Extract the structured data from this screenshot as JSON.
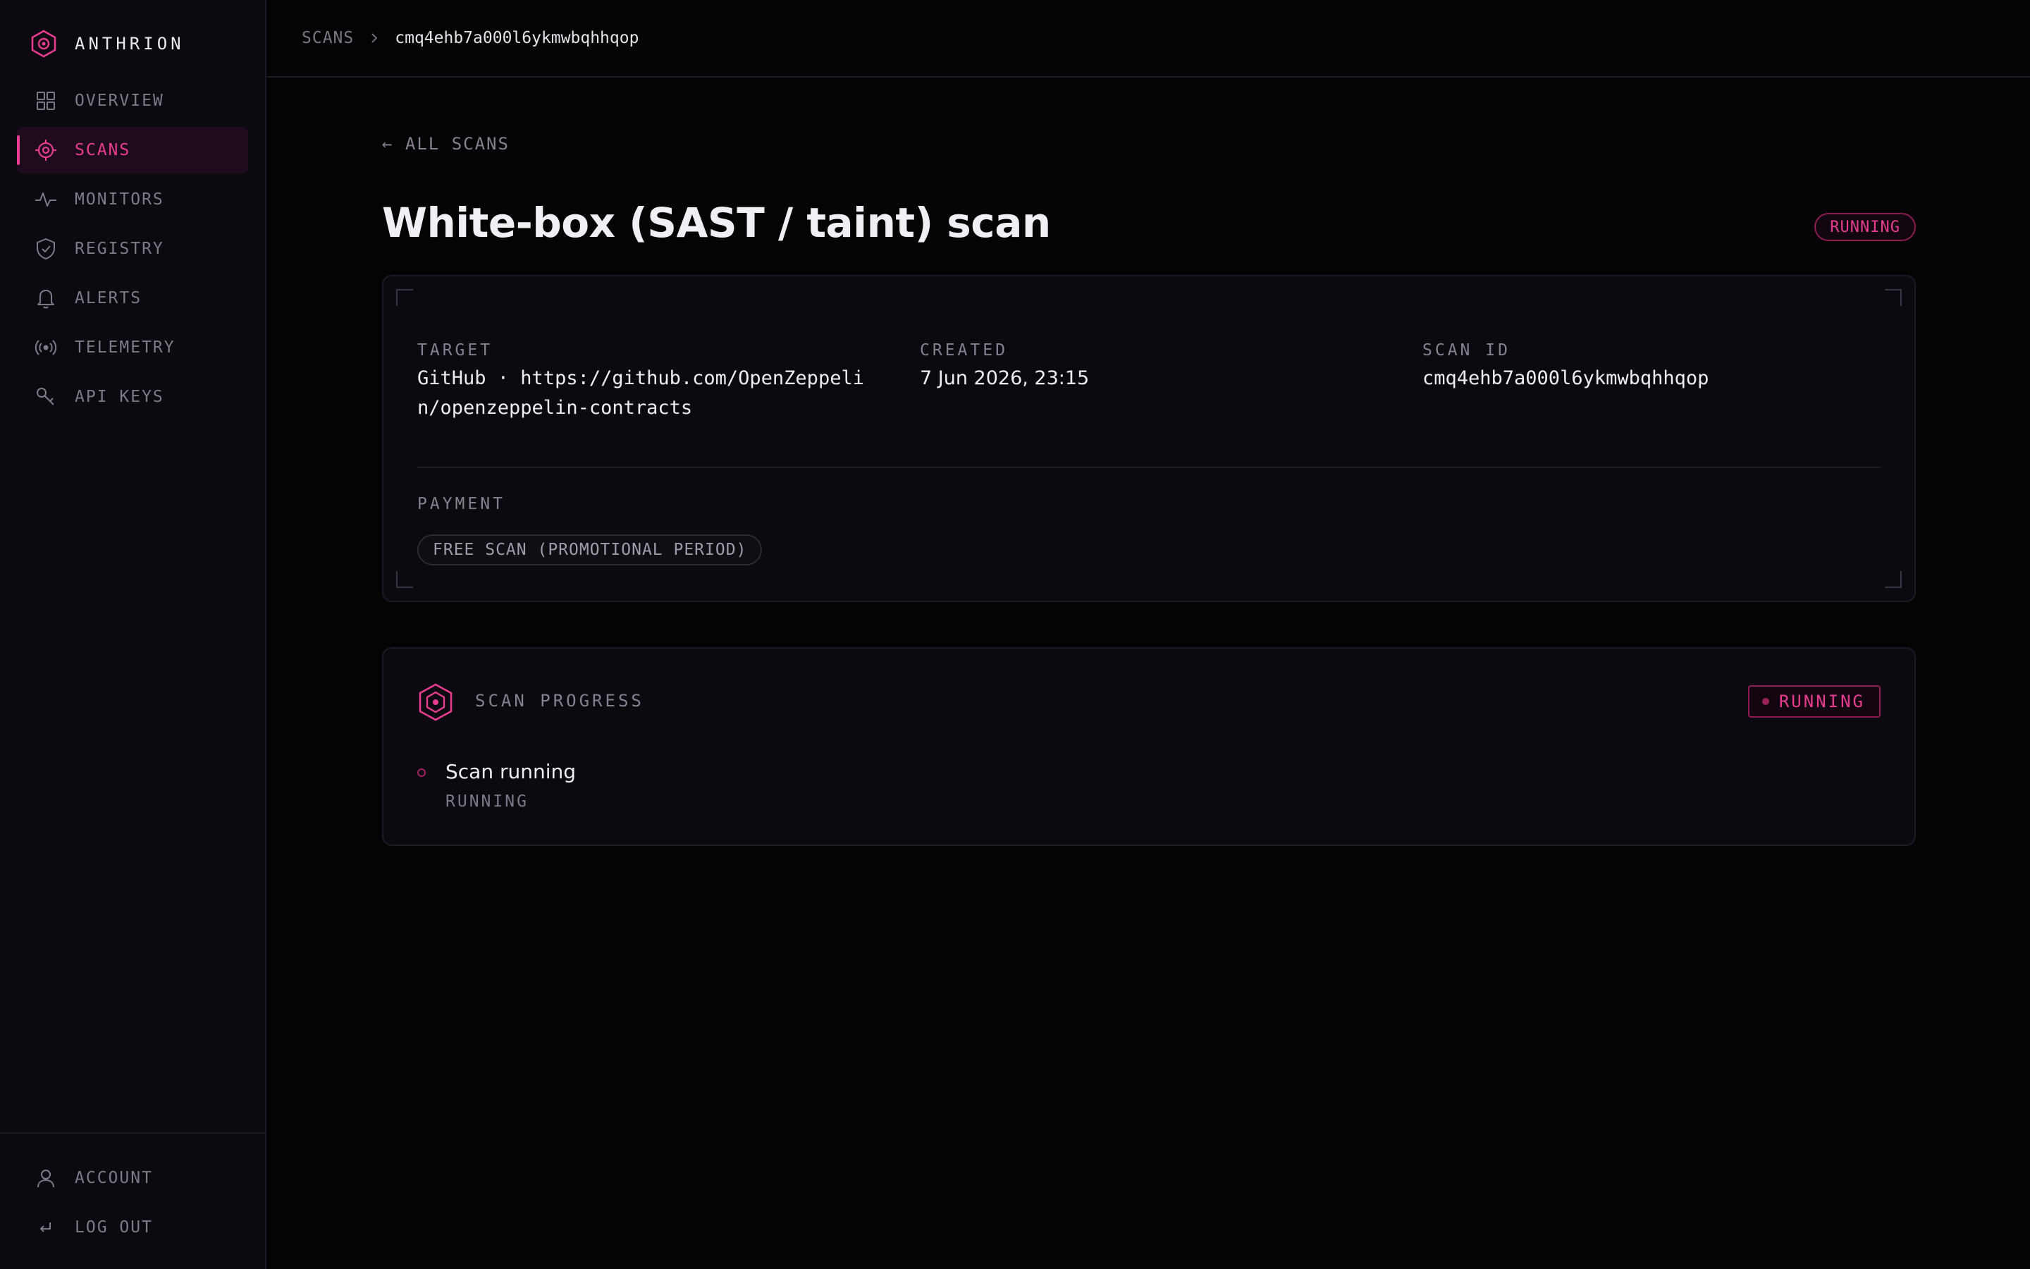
{
  "brand": {
    "name": "ANTHRION"
  },
  "sidebar": {
    "items": [
      {
        "label": "OVERVIEW",
        "icon": "grid-icon"
      },
      {
        "label": "SCANS",
        "icon": "target-icon",
        "active": true
      },
      {
        "label": "MONITORS",
        "icon": "pulse-icon"
      },
      {
        "label": "REGISTRY",
        "icon": "shield-check-icon"
      },
      {
        "label": "ALERTS",
        "icon": "bell-icon"
      },
      {
        "label": "TELEMETRY",
        "icon": "broadcast-icon"
      },
      {
        "label": "API KEYS",
        "icon": "key-icon"
      }
    ],
    "bottom": [
      {
        "label": "ACCOUNT",
        "icon": "user-icon"
      },
      {
        "label": "LOG OUT",
        "icon": "logout-icon"
      }
    ]
  },
  "breadcrumb": {
    "root": "SCANS",
    "current": "cmq4ehb7a000l6ykmwbqhhqop"
  },
  "page": {
    "back_label": "← ALL SCANS",
    "title": "White-box (SAST / taint) scan",
    "status": "RUNNING"
  },
  "details": {
    "target_label": "TARGET",
    "target_value_line1": "GitHub · https://github.com/OpenZeppeli",
    "target_value_line2": "n/openzeppelin-contracts",
    "created_label": "CREATED",
    "created_value": "7 Jun 2026, 23:15",
    "scan_id_label": "SCAN ID",
    "scan_id_value": "cmq4ehb7a000l6ykmwbqhhqop",
    "payment_label": "PAYMENT",
    "payment_value": "FREE SCAN (PROMOTIONAL PERIOD)"
  },
  "progress": {
    "title": "SCAN PROGRESS",
    "badge": "RUNNING",
    "steps": [
      {
        "title": "Scan running",
        "status": "RUNNING"
      }
    ]
  },
  "colors": {
    "accent": "#e83d8f",
    "background": "#040305",
    "panel": "#0c0a10"
  }
}
